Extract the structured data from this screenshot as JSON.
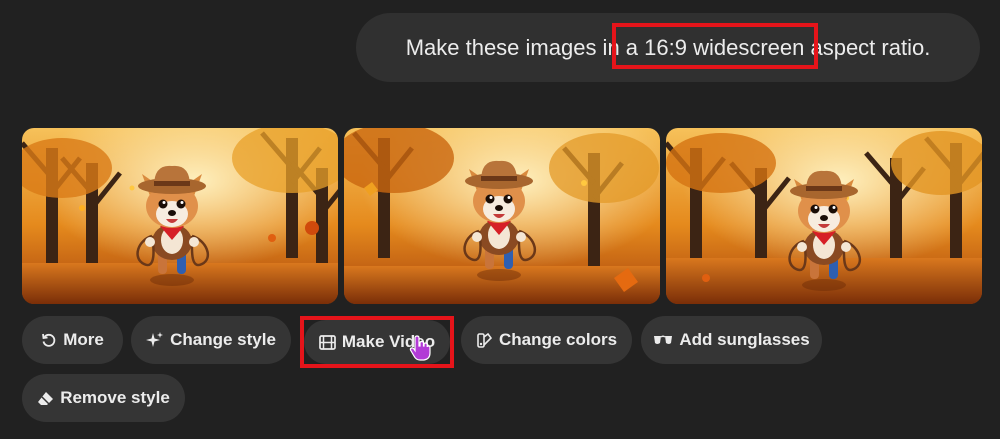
{
  "message": {
    "before": "Make these images in",
    "highlight": " a 16:9 widescreen",
    "after": " aspect ratio."
  },
  "images": [
    {
      "alt": "corgi-cowboy-autumn-1"
    },
    {
      "alt": "corgi-cowboy-autumn-2"
    },
    {
      "alt": "corgi-cowboy-autumn-3"
    }
  ],
  "actions": {
    "more": "More",
    "change_style": "Change style",
    "make_video": "Make Video",
    "change_colors": "Change colors",
    "add_sunglasses": "Add sunglasses",
    "remove_style": "Remove style"
  },
  "colors": {
    "background": "#212121",
    "bubble": "#303030",
    "chip": "#353535",
    "highlight_box": "#e5141a",
    "cursor": "#b23bd6"
  }
}
